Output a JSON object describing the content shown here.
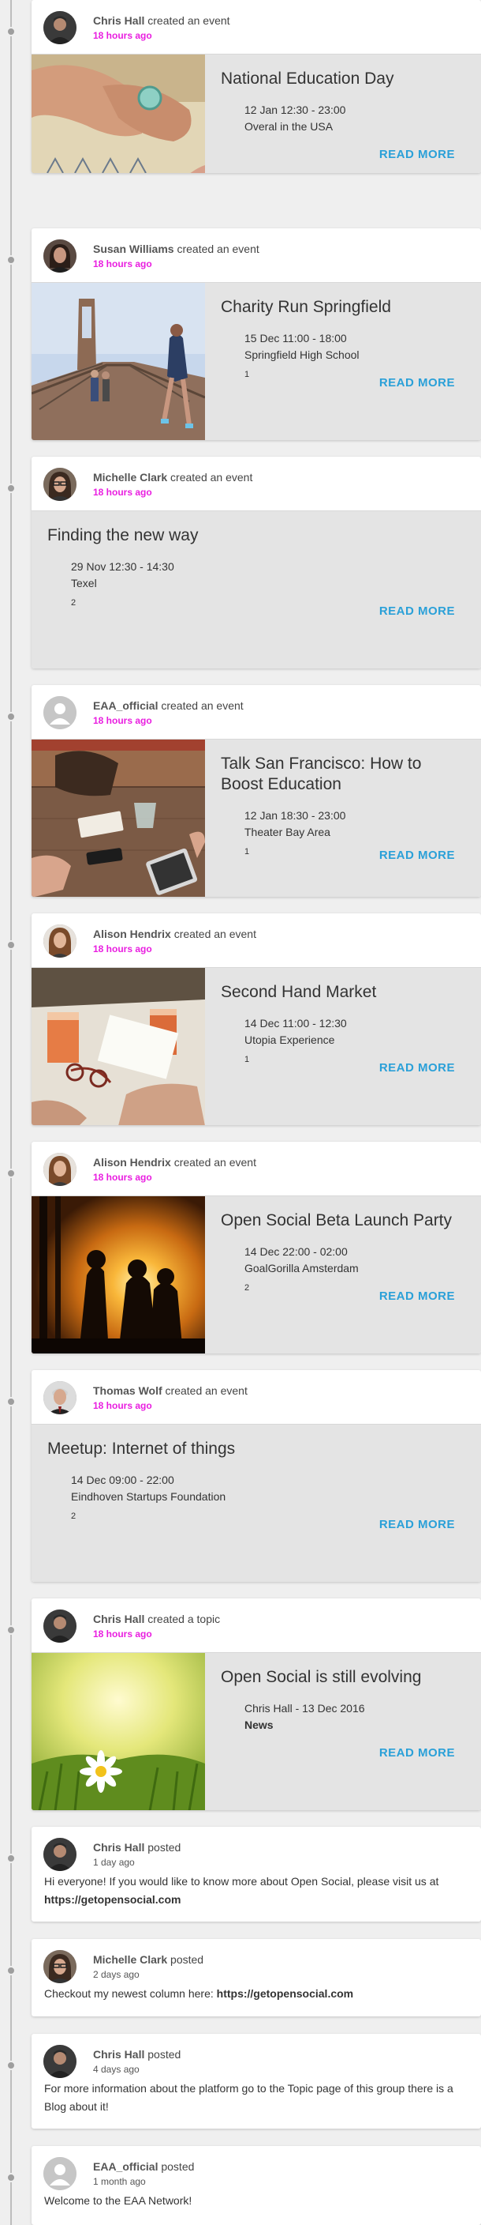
{
  "colors": {
    "accent_link": "#2aa0d8",
    "timestamp": "#e91ee0",
    "card_body": "#e4e4e4",
    "background": "#efefef"
  },
  "events": [
    {
      "actor": "Chris Hall",
      "action": "created an event",
      "time": "18 hours ago",
      "title": "National Education Day",
      "date": "12 Jan 12:30 - 23:00",
      "location": "Overal in the USA",
      "count": "",
      "read_more": "READ MORE",
      "thumb": "hands-illustration"
    },
    {
      "actor": "Susan Williams",
      "action": "created an event",
      "time": "18 hours ago",
      "title": "Charity Run Springfield",
      "date": "15 Dec 11:00 - 18:00",
      "location": "Springfield High School",
      "count": "1",
      "read_more": "READ MORE",
      "thumb": "bridge-runner"
    },
    {
      "actor": "Michelle Clark",
      "action": "created an event",
      "time": "18 hours ago",
      "title": "Finding the new way",
      "date": "29 Nov 12:30 - 14:30",
      "location": "Texel",
      "count": "2",
      "read_more": "READ MORE",
      "thumb": ""
    },
    {
      "actor": "EAA_official",
      "action": "created an event",
      "time": "18 hours ago",
      "title": "Talk San Francisco: How to Boost Education",
      "date": "12 Jan 18:30 - 23:00",
      "location": "Theater Bay Area",
      "count": "1",
      "read_more": "READ MORE",
      "thumb": "table-tablet"
    },
    {
      "actor": "Alison Hendrix",
      "action": "created an event",
      "time": "18 hours ago",
      "title": "Second Hand Market",
      "date": "14 Dec 11:00 - 12:30",
      "location": "Utopia Experience",
      "count": "1",
      "read_more": "READ MORE",
      "thumb": "drinks-table"
    },
    {
      "actor": "Alison Hendrix",
      "action": "created an event",
      "time": "18 hours ago",
      "title": "Open Social Beta Launch Party",
      "date": "14 Dec 22:00 - 02:00",
      "location": "GoalGorilla Amsterdam",
      "count": "2",
      "read_more": "READ MORE",
      "thumb": "sunset-people"
    },
    {
      "actor": "Thomas Wolf",
      "action": "created an event",
      "time": "18 hours ago",
      "title": "Meetup: Internet of things",
      "date": "14 Dec 09:00 - 22:00",
      "location": "Eindhoven Startups Foundation",
      "count": "2",
      "read_more": "READ MORE",
      "thumb": ""
    }
  ],
  "topic": {
    "actor": "Chris Hall",
    "action": "created a topic",
    "time": "18 hours ago",
    "title": "Open Social is still evolving",
    "byline": "Chris Hall - 13 Dec 2016",
    "category": "News",
    "read_more": "READ MORE"
  },
  "posts": [
    {
      "actor": "Chris Hall",
      "action": "posted",
      "time": "1 day ago",
      "text": "Hi everyone! If you would like to know more about Open Social, please visit us at ",
      "link": "https://getopensocial.com"
    },
    {
      "actor": "Michelle Clark",
      "action": "posted",
      "time": "2 days ago",
      "text": "Checkout my newest column here: ",
      "link": "https://getopensocial.com"
    },
    {
      "actor": "Chris Hall",
      "action": "posted",
      "time": "4 days ago",
      "text": "For more information about the platform go to the Topic page of this group there is a Blog about it!",
      "link": ""
    },
    {
      "actor": "EAA_official",
      "action": "posted",
      "time": "1 month ago",
      "text": "Welcome to the EAA Network!",
      "link": ""
    }
  ]
}
